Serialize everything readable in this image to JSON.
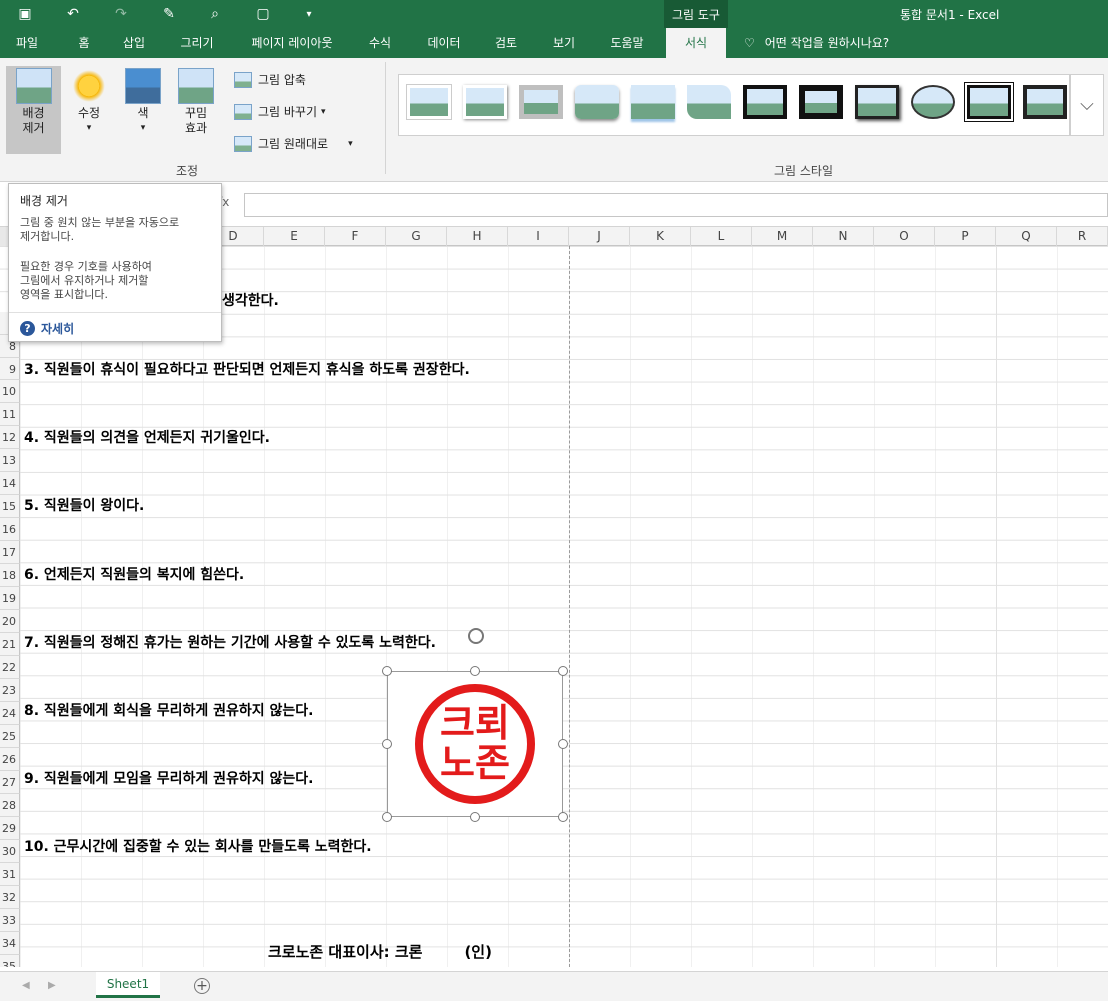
{
  "window": {
    "title": "통합 문서1  -  Excel",
    "context_tab": "그림 도구"
  },
  "tabs": [
    "파일",
    "홈",
    "삽입",
    "그리기",
    "페이지 레이아웃",
    "수식",
    "데이터",
    "검토",
    "보기",
    "도움말",
    "서식"
  ],
  "active_tab": "서식",
  "tell_me": "어떤 작업을 원하시나요?",
  "ribbon": {
    "remove_bg": "배경\n제거",
    "remove_bg_l1": "배경",
    "remove_bg_l2": "제거",
    "corrections": "수정",
    "color": "색",
    "artistic_l1": "꾸밈",
    "artistic_l2": "효과",
    "compress": "그림 압축",
    "change": "그림 바꾸기",
    "reset": "그림 원래대로",
    "group_adjust": "조정",
    "group_styles": "그림 스타일"
  },
  "tooltip": {
    "title": "배경 제거",
    "line1": "그림 중 원치 않는 부분을 자동으로",
    "line2": "제거합니다.",
    "line3": "필요한 경우 기호를 사용하여",
    "line4": "그림에서 유지하거나 제거할",
    "line5": "영역을 표시합니다.",
    "more": "자세히"
  },
  "columns": [
    "D",
    "E",
    "F",
    "G",
    "H",
    "I",
    "J",
    "K",
    "L",
    "M",
    "N",
    "O",
    "P",
    "Q",
    "R"
  ],
  "rows": [
    "7",
    "8",
    "9",
    "10",
    "11",
    "12",
    "13",
    "14",
    "15",
    "16",
    "17",
    "18",
    "19",
    "20",
    "21",
    "22",
    "23",
    "24",
    "25",
    "26",
    "27",
    "28",
    "29",
    "30",
    "31",
    "32",
    "33",
    "34",
    "35"
  ],
  "cells": {
    "r6_partial": "생각한다.",
    "r9": "3. 직원들이 휴식이 필요하다고 판단되면 언제든지 휴식을 하도록 권장한다.",
    "r12": "4. 직원들의 의견을 언제든지 귀기울인다.",
    "r15": "5. 직원들이 왕이다.",
    "r18": "6. 언제든지 직원들의 복지에 힘쓴다.",
    "r21": "7. 직원들의 정해진 휴가는 원하는 기간에 사용할 수 있도록 노력한다.",
    "r24": "8. 직원들에게 회식을 무리하게 권유하지 않는다.",
    "r27": "9. 직원들에게 모임을 무리하게 권유하지 않는다.",
    "r30": "10. 근무시간에 집중할 수 있는 회사를 만들도록 노력한다.",
    "r35_sig": "크로노존 대표이사: 크론",
    "r35_seal": "(인)"
  },
  "seal": {
    "line1": "크뢰",
    "line2": "노존",
    "color": "#e31b1b"
  },
  "sheet_tab": "Sheet1",
  "colors": {
    "excel_green": "#217346"
  }
}
